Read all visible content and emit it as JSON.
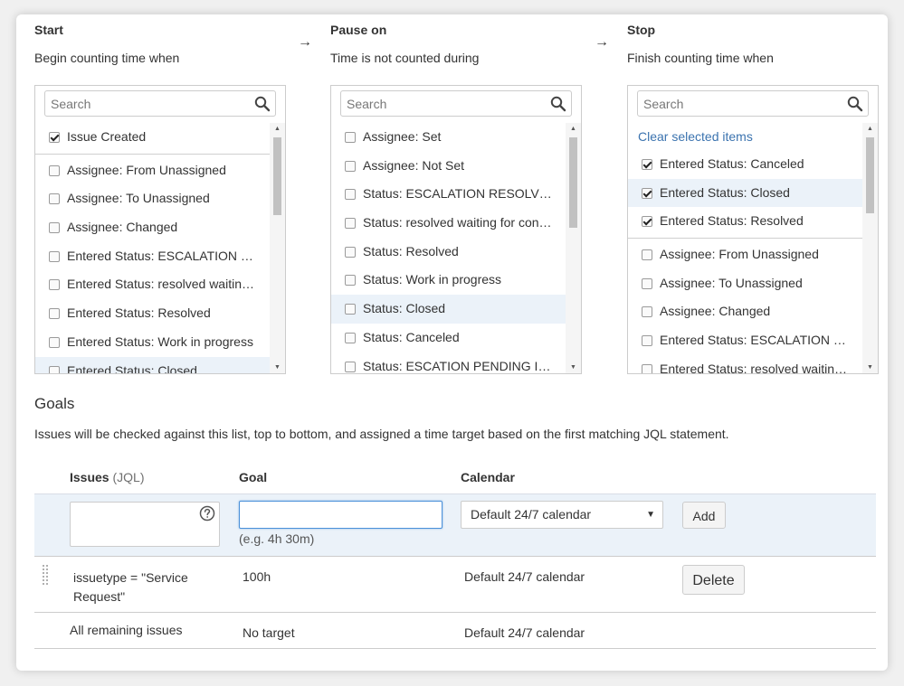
{
  "columns": [
    {
      "title": "Start",
      "subtitle": "Begin counting time when",
      "search_placeholder": "Search"
    },
    {
      "title": "Pause on",
      "subtitle": "Time is not counted during",
      "search_placeholder": "Search"
    },
    {
      "title": "Stop",
      "subtitle": "Finish counting time when",
      "search_placeholder": "Search",
      "clear_label": "Clear selected items"
    }
  ],
  "arrow_glyph": "→",
  "start_selected": [
    "Issue Created"
  ],
  "start_items": [
    "Assignee: From Unassigned",
    "Assignee: To Unassigned",
    "Assignee: Changed",
    "Entered Status: ESCALATION …",
    "Entered Status: resolved waitin…",
    "Entered Status: Resolved",
    "Entered Status: Work in progress",
    "Entered Status: Closed"
  ],
  "pause_items": [
    "Assignee: Set",
    "Assignee: Not Set",
    "Status: ESCALATION RESOLV…",
    "Status: resolved waiting for con…",
    "Status: Resolved",
    "Status: Work in progress",
    "Status: Closed",
    "Status: Canceled",
    "Status: ESCATION PENDING I…"
  ],
  "stop_selected": [
    "Entered Status: Canceled",
    "Entered Status: Closed",
    "Entered Status: Resolved"
  ],
  "stop_items": [
    "Assignee: From Unassigned",
    "Assignee: To Unassigned",
    "Assignee: Changed",
    "Entered Status: ESCALATION …",
    "Entered Status: resolved waitin…"
  ],
  "goals": {
    "title": "Goals",
    "description": "Issues will be checked against this list, top to bottom, and assigned a time target based on the first matching JQL statement.",
    "header_issues": "Issues",
    "header_issues_muted": "(JQL)",
    "header_goal": "Goal",
    "header_calendar": "Calendar",
    "new_row": {
      "jql_value": "",
      "goal_value": "",
      "goal_hint": "(e.g. 4h 30m)",
      "calendar_value": "Default 24/7 calendar",
      "add_label": "Add"
    },
    "rows": [
      {
        "issues_line1": "issuetype = \"Service",
        "issues_line2": "Request\"",
        "goal": "100h",
        "calendar": "Default 24/7 calendar",
        "delete_label": "Delete"
      }
    ],
    "remaining": {
      "issues": "All remaining issues",
      "goal": "No target",
      "calendar": "Default 24/7 calendar"
    }
  },
  "colors": {
    "accent_link": "#3b73af",
    "row_highlight": "#ebf2f9",
    "focus_border": "#4a90d9"
  },
  "icons": {
    "search": "search-icon",
    "help": "help-icon",
    "drag": "drag-handle-icon",
    "caret": "caret-down-icon"
  }
}
